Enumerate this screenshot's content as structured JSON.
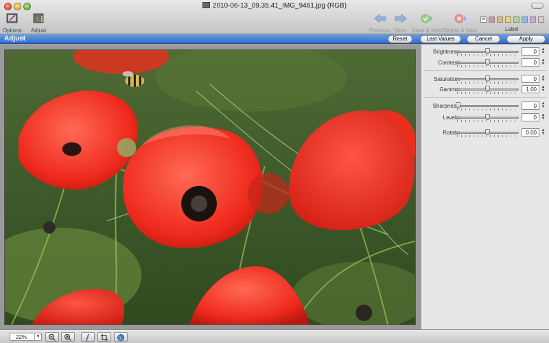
{
  "window": {
    "title": "2010-06-13_09.35.41_IMG_9461.jpg (RGB)"
  },
  "toolbar": {
    "options_label": "Options",
    "adjust_label": "Adjust",
    "previous_label": "Previous",
    "next_label": "Next",
    "save_next_label": "Save & Next",
    "delete_next_label": "Delete & Next",
    "label_label": "Label",
    "label_colors": [
      "#ffffff",
      "#e58c8c",
      "#f0b070",
      "#e8d870",
      "#a8d890",
      "#90b8e8",
      "#c8a8e0",
      "#cfcfcf"
    ]
  },
  "adjust_bar": {
    "title": "Adjust",
    "reset": "Reset",
    "last_values": "Last Values",
    "cancel": "Cancel",
    "apply": "Apply"
  },
  "sliders": {
    "brightness": {
      "label": "Brightness:",
      "value": "0",
      "level": 0.5
    },
    "contrast": {
      "label": "Contrast:",
      "value": "0",
      "level": 0.5
    },
    "saturation": {
      "label": "Saturation:",
      "value": "0",
      "level": 0.5
    },
    "gamma": {
      "label": "Gamma:",
      "value": "1.00",
      "level": 0.5
    },
    "sharpness": {
      "label": "Sharpness:",
      "value": "0",
      "level": 0.0
    },
    "levels": {
      "label": "Levels:",
      "value": "0",
      "level": 0.5
    },
    "rotate": {
      "label": "Rotate:",
      "value": "0.00",
      "level": 0.5
    }
  },
  "bottom": {
    "zoom": "22%"
  },
  "colors": {
    "accent": "#2f6cc8"
  }
}
